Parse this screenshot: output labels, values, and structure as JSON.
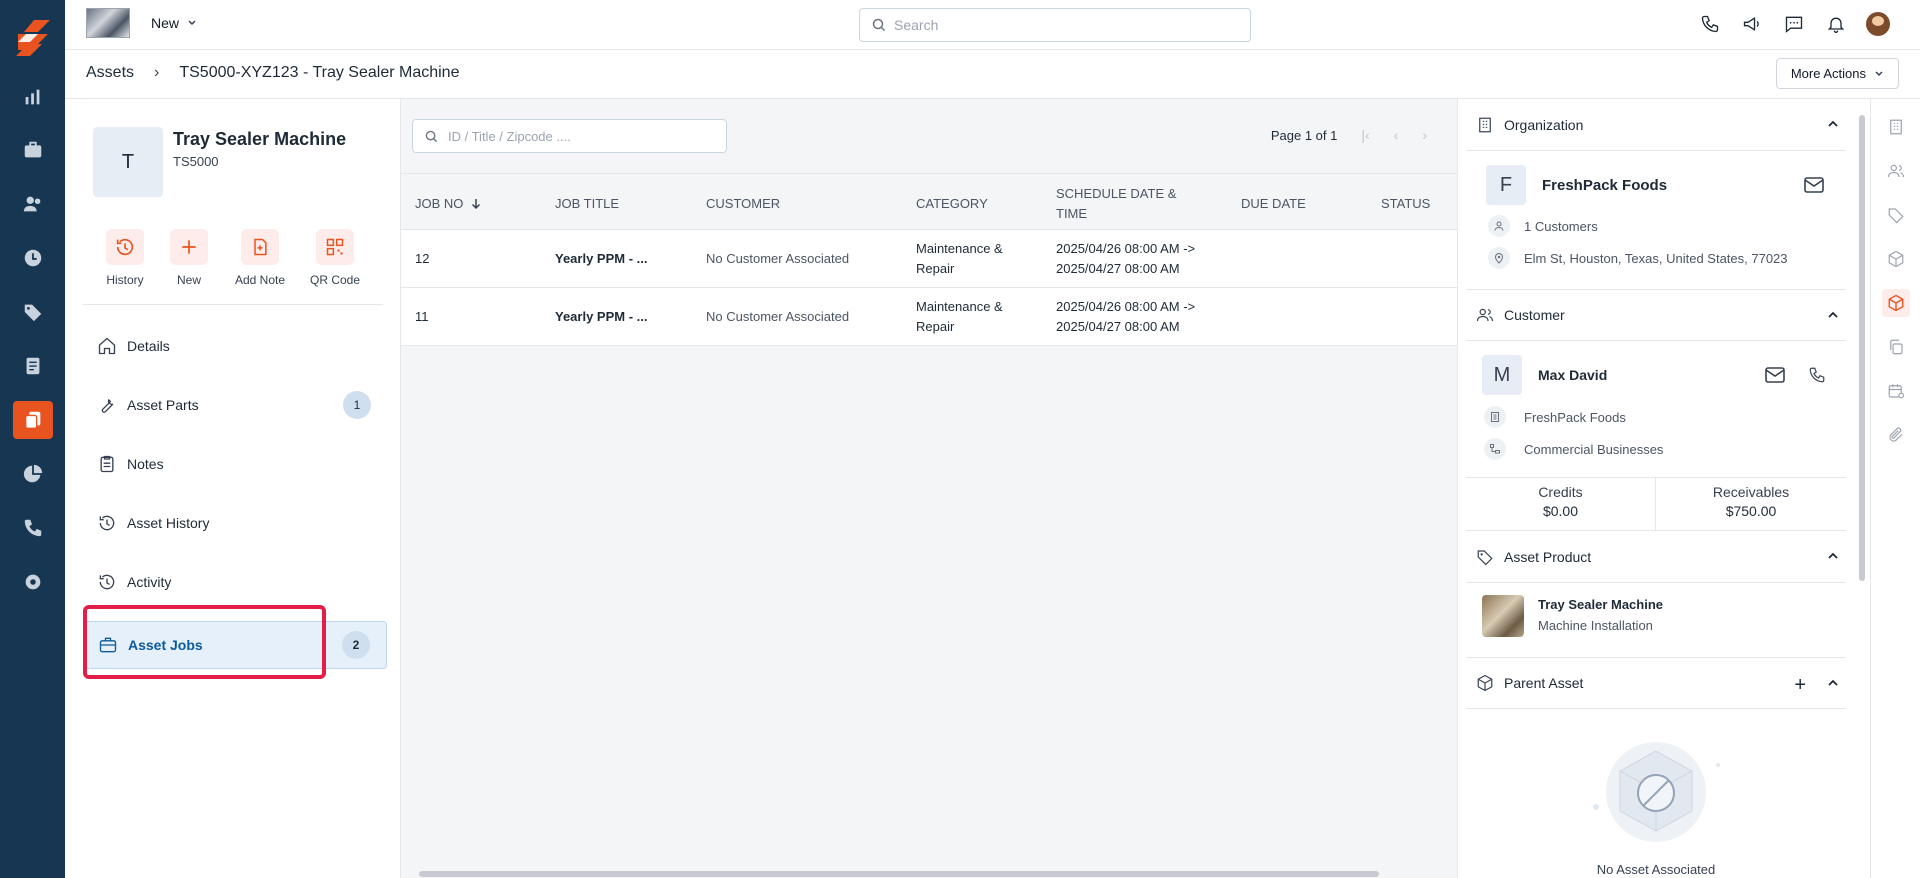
{
  "topbar": {
    "new_label": "New",
    "search_placeholder": "Search"
  },
  "breadcrumb": {
    "root": "Assets",
    "current": "TS5000-XYZ123 - Tray Sealer Machine"
  },
  "more_actions_label": "More Actions",
  "asset": {
    "avatar_letter": "T",
    "name": "Tray Sealer Machine",
    "code": "TS5000"
  },
  "quick_actions": [
    {
      "label": "History",
      "icon": "history-icon"
    },
    {
      "label": "New",
      "icon": "plus-icon"
    },
    {
      "label": "Add Note",
      "icon": "add-note-icon"
    },
    {
      "label": "QR Code",
      "icon": "qr-code-icon"
    }
  ],
  "nav": [
    {
      "label": "Details",
      "icon": "home-icon",
      "badge": ""
    },
    {
      "label": "Asset Parts",
      "icon": "wrench-icon",
      "badge": "1"
    },
    {
      "label": "Notes",
      "icon": "clipboard-icon",
      "badge": ""
    },
    {
      "label": "Asset History",
      "icon": "history-icon",
      "badge": ""
    },
    {
      "label": "Activity",
      "icon": "history-icon",
      "badge": ""
    },
    {
      "label": "Asset Jobs",
      "icon": "briefcase-icon",
      "badge": "2",
      "active": true
    }
  ],
  "jobs": {
    "search_placeholder": "ID / Title / Zipcode ....",
    "page_label": "Page 1 of 1",
    "columns": [
      "JOB NO",
      "JOB TITLE",
      "CUSTOMER",
      "CATEGORY",
      "SCHEDULE DATE & TIME",
      "DUE DATE",
      "STATUS"
    ],
    "rows": [
      {
        "job_no": "12",
        "title": "Yearly PPM - ...",
        "customer": "No Customer Associated",
        "category": "Maintenance & Repair",
        "schedule": "2025/04/26 08:00 AM -> 2025/04/27 08:00 AM",
        "due": "",
        "status": ""
      },
      {
        "job_no": "11",
        "title": "Yearly PPM - ...",
        "customer": "No Customer Associated",
        "category": "Maintenance & Repair",
        "schedule": "2025/04/26 08:00 AM -> 2025/04/27 08:00 AM",
        "due": "",
        "status": ""
      }
    ]
  },
  "organization": {
    "heading": "Organization",
    "avatar_letter": "F",
    "name": "FreshPack Foods",
    "customers": "1 Customers",
    "address": "Elm St, Houston, Texas, United States, 77023"
  },
  "customer": {
    "heading": "Customer",
    "avatar_letter": "M",
    "name": "Max David",
    "org": "FreshPack Foods",
    "type": "Commercial Businesses",
    "credits_label": "Credits",
    "credits_value": "$0.00",
    "receivables_label": "Receivables",
    "receivables_value": "$750.00"
  },
  "asset_product": {
    "heading": "Asset Product",
    "name": "Tray Sealer Machine",
    "sub": "Machine Installation"
  },
  "parent_asset": {
    "heading": "Parent Asset",
    "empty_text": "No Asset Associated"
  },
  "colors": {
    "rail": "#163651",
    "accent": "#e8531f",
    "active_nav": "#e6f0fb",
    "highlight": "#e11d48"
  }
}
